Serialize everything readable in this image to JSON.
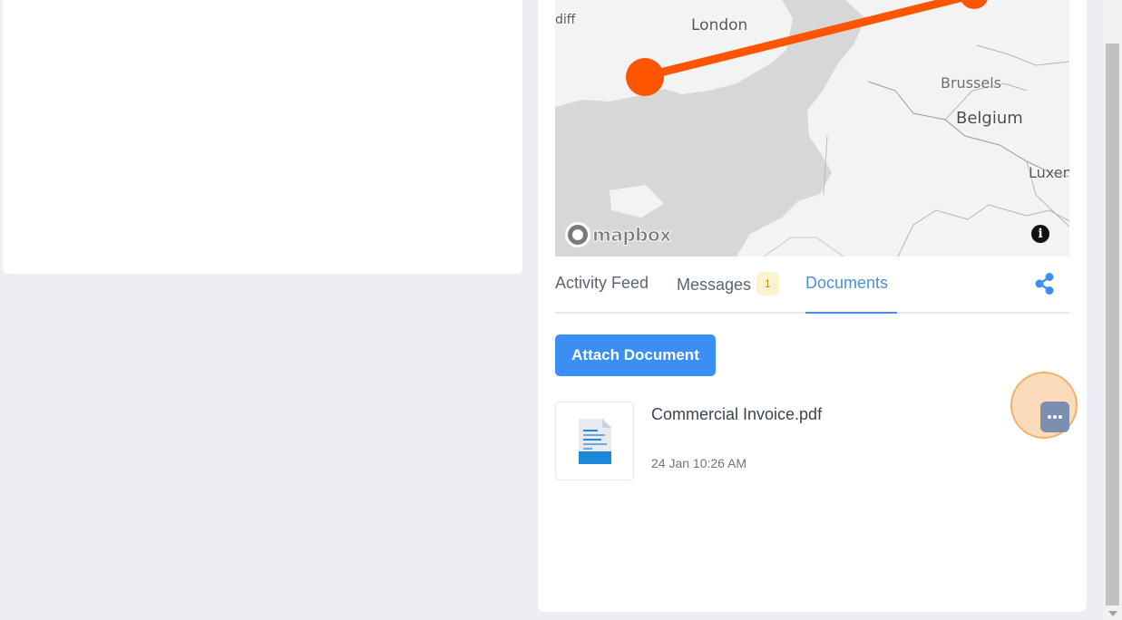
{
  "map": {
    "labels": {
      "diff": "diff",
      "london": "London",
      "brussels": "Brussels",
      "belgium": "Belgium",
      "luxem": "Luxen"
    },
    "attribution": "mapbox",
    "info_glyph": "i",
    "route_color": "#ff5500"
  },
  "tabs": [
    {
      "label": "Activity Feed",
      "active": false
    },
    {
      "label": "Messages",
      "badge": "1",
      "active": false
    },
    {
      "label": "Documents",
      "active": true
    }
  ],
  "share_icon": "share-icon",
  "attach_button": "Attach Document",
  "documents": [
    {
      "name": "Commercial Invoice.pdf",
      "timestamp": "24 Jan 10:26 AM",
      "icon": "document-file-icon"
    }
  ],
  "more_icon": "more-horizontal-icon",
  "colors": {
    "accent": "#3b8ff3",
    "tab_active": "#4a8fe0",
    "badge_bg": "#fdf2d0",
    "page_bg": "#eceef3"
  }
}
